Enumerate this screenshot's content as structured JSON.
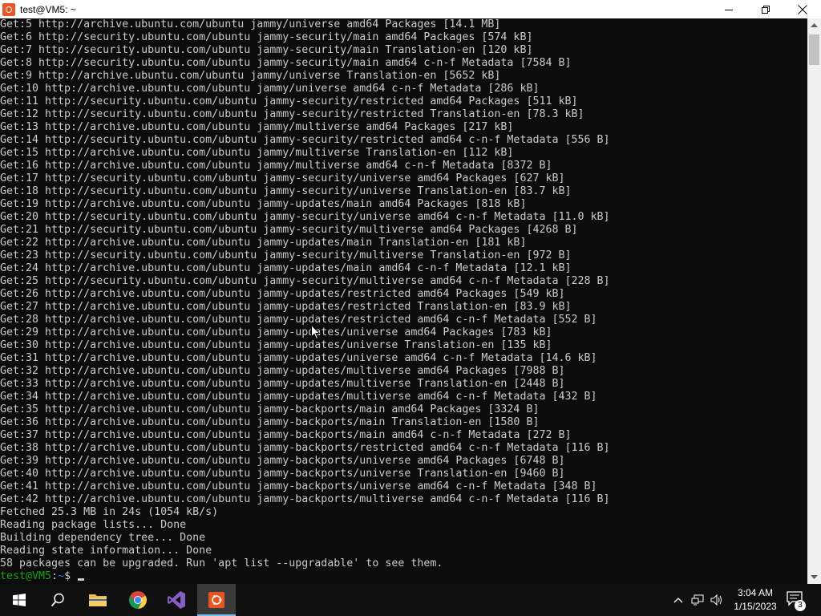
{
  "window": {
    "title": "test@VM5: ~",
    "app_icon": "ubuntu-terminal-icon",
    "controls": [
      "minimize",
      "maximize",
      "close"
    ]
  },
  "terminal": {
    "lines": [
      "Get:5 http://archive.ubuntu.com/ubuntu jammy/universe amd64 Packages [14.1 MB]",
      "Get:6 http://security.ubuntu.com/ubuntu jammy-security/main amd64 Packages [574 kB]",
      "Get:7 http://security.ubuntu.com/ubuntu jammy-security/main Translation-en [120 kB]",
      "Get:8 http://security.ubuntu.com/ubuntu jammy-security/main amd64 c-n-f Metadata [7584 B]",
      "Get:9 http://archive.ubuntu.com/ubuntu jammy/universe Translation-en [5652 kB]",
      "Get:10 http://archive.ubuntu.com/ubuntu jammy/universe amd64 c-n-f Metadata [286 kB]",
      "Get:11 http://security.ubuntu.com/ubuntu jammy-security/restricted amd64 Packages [511 kB]",
      "Get:12 http://security.ubuntu.com/ubuntu jammy-security/restricted Translation-en [78.3 kB]",
      "Get:13 http://archive.ubuntu.com/ubuntu jammy/multiverse amd64 Packages [217 kB]",
      "Get:14 http://security.ubuntu.com/ubuntu jammy-security/restricted amd64 c-n-f Metadata [556 B]",
      "Get:15 http://archive.ubuntu.com/ubuntu jammy/multiverse Translation-en [112 kB]",
      "Get:16 http://archive.ubuntu.com/ubuntu jammy/multiverse amd64 c-n-f Metadata [8372 B]",
      "Get:17 http://security.ubuntu.com/ubuntu jammy-security/universe amd64 Packages [627 kB]",
      "Get:18 http://security.ubuntu.com/ubuntu jammy-security/universe Translation-en [83.7 kB]",
      "Get:19 http://archive.ubuntu.com/ubuntu jammy-updates/main amd64 Packages [818 kB]",
      "Get:20 http://security.ubuntu.com/ubuntu jammy-security/universe amd64 c-n-f Metadata [11.0 kB]",
      "Get:21 http://security.ubuntu.com/ubuntu jammy-security/multiverse amd64 Packages [4268 B]",
      "Get:22 http://archive.ubuntu.com/ubuntu jammy-updates/main Translation-en [181 kB]",
      "Get:23 http://security.ubuntu.com/ubuntu jammy-security/multiverse Translation-en [972 B]",
      "Get:24 http://archive.ubuntu.com/ubuntu jammy-updates/main amd64 c-n-f Metadata [12.1 kB]",
      "Get:25 http://security.ubuntu.com/ubuntu jammy-security/multiverse amd64 c-n-f Metadata [228 B]",
      "Get:26 http://archive.ubuntu.com/ubuntu jammy-updates/restricted amd64 Packages [549 kB]",
      "Get:27 http://archive.ubuntu.com/ubuntu jammy-updates/restricted Translation-en [83.9 kB]",
      "Get:28 http://archive.ubuntu.com/ubuntu jammy-updates/restricted amd64 c-n-f Metadata [552 B]",
      "Get:29 http://archive.ubuntu.com/ubuntu jammy-updates/universe amd64 Packages [783 kB]",
      "Get:30 http://archive.ubuntu.com/ubuntu jammy-updates/universe Translation-en [135 kB]",
      "Get:31 http://archive.ubuntu.com/ubuntu jammy-updates/universe amd64 c-n-f Metadata [14.6 kB]",
      "Get:32 http://archive.ubuntu.com/ubuntu jammy-updates/multiverse amd64 Packages [7988 B]",
      "Get:33 http://archive.ubuntu.com/ubuntu jammy-updates/multiverse Translation-en [2448 B]",
      "Get:34 http://archive.ubuntu.com/ubuntu jammy-updates/multiverse amd64 c-n-f Metadata [432 B]",
      "Get:35 http://archive.ubuntu.com/ubuntu jammy-backports/main amd64 Packages [3324 B]",
      "Get:36 http://archive.ubuntu.com/ubuntu jammy-backports/main Translation-en [1580 B]",
      "Get:37 http://archive.ubuntu.com/ubuntu jammy-backports/main amd64 c-n-f Metadata [272 B]",
      "Get:38 http://archive.ubuntu.com/ubuntu jammy-backports/restricted amd64 c-n-f Metadata [116 B]",
      "Get:39 http://archive.ubuntu.com/ubuntu jammy-backports/universe amd64 Packages [6748 B]",
      "Get:40 http://archive.ubuntu.com/ubuntu jammy-backports/universe Translation-en [9460 B]",
      "Get:41 http://archive.ubuntu.com/ubuntu jammy-backports/universe amd64 c-n-f Metadata [348 B]",
      "Get:42 http://archive.ubuntu.com/ubuntu jammy-backports/multiverse amd64 c-n-f Metadata [116 B]",
      "Fetched 25.3 MB in 24s (1054 kB/s)",
      "Reading package lists... Done",
      "Building dependency tree... Done",
      "Reading state information... Done",
      "58 packages can be upgraded. Run 'apt list --upgradable' to see them."
    ],
    "prompt": {
      "user_host": "test@VM5",
      "separator": ":",
      "path": "~",
      "symbol": "$ "
    },
    "colors": {
      "background": "#0c0c0c",
      "text": "#cccccc",
      "prompt_user": "#13a10e",
      "prompt_path": "#3b78ff"
    }
  },
  "taskbar": {
    "apps": [
      {
        "name": "start",
        "icon": "windows-logo-icon"
      },
      {
        "name": "search",
        "icon": "search-icon"
      },
      {
        "name": "file-explorer",
        "icon": "folder-icon"
      },
      {
        "name": "chrome",
        "icon": "chrome-icon"
      },
      {
        "name": "visual-studio",
        "icon": "visual-studio-icon"
      },
      {
        "name": "ubuntu",
        "icon": "ubuntu-terminal-icon",
        "active": true
      }
    ],
    "tray": {
      "icons": [
        "chevron-up-icon",
        "network-icon",
        "volume-icon"
      ],
      "time": "3:04 AM",
      "date": "1/15/2023",
      "notification_count": "3"
    }
  }
}
